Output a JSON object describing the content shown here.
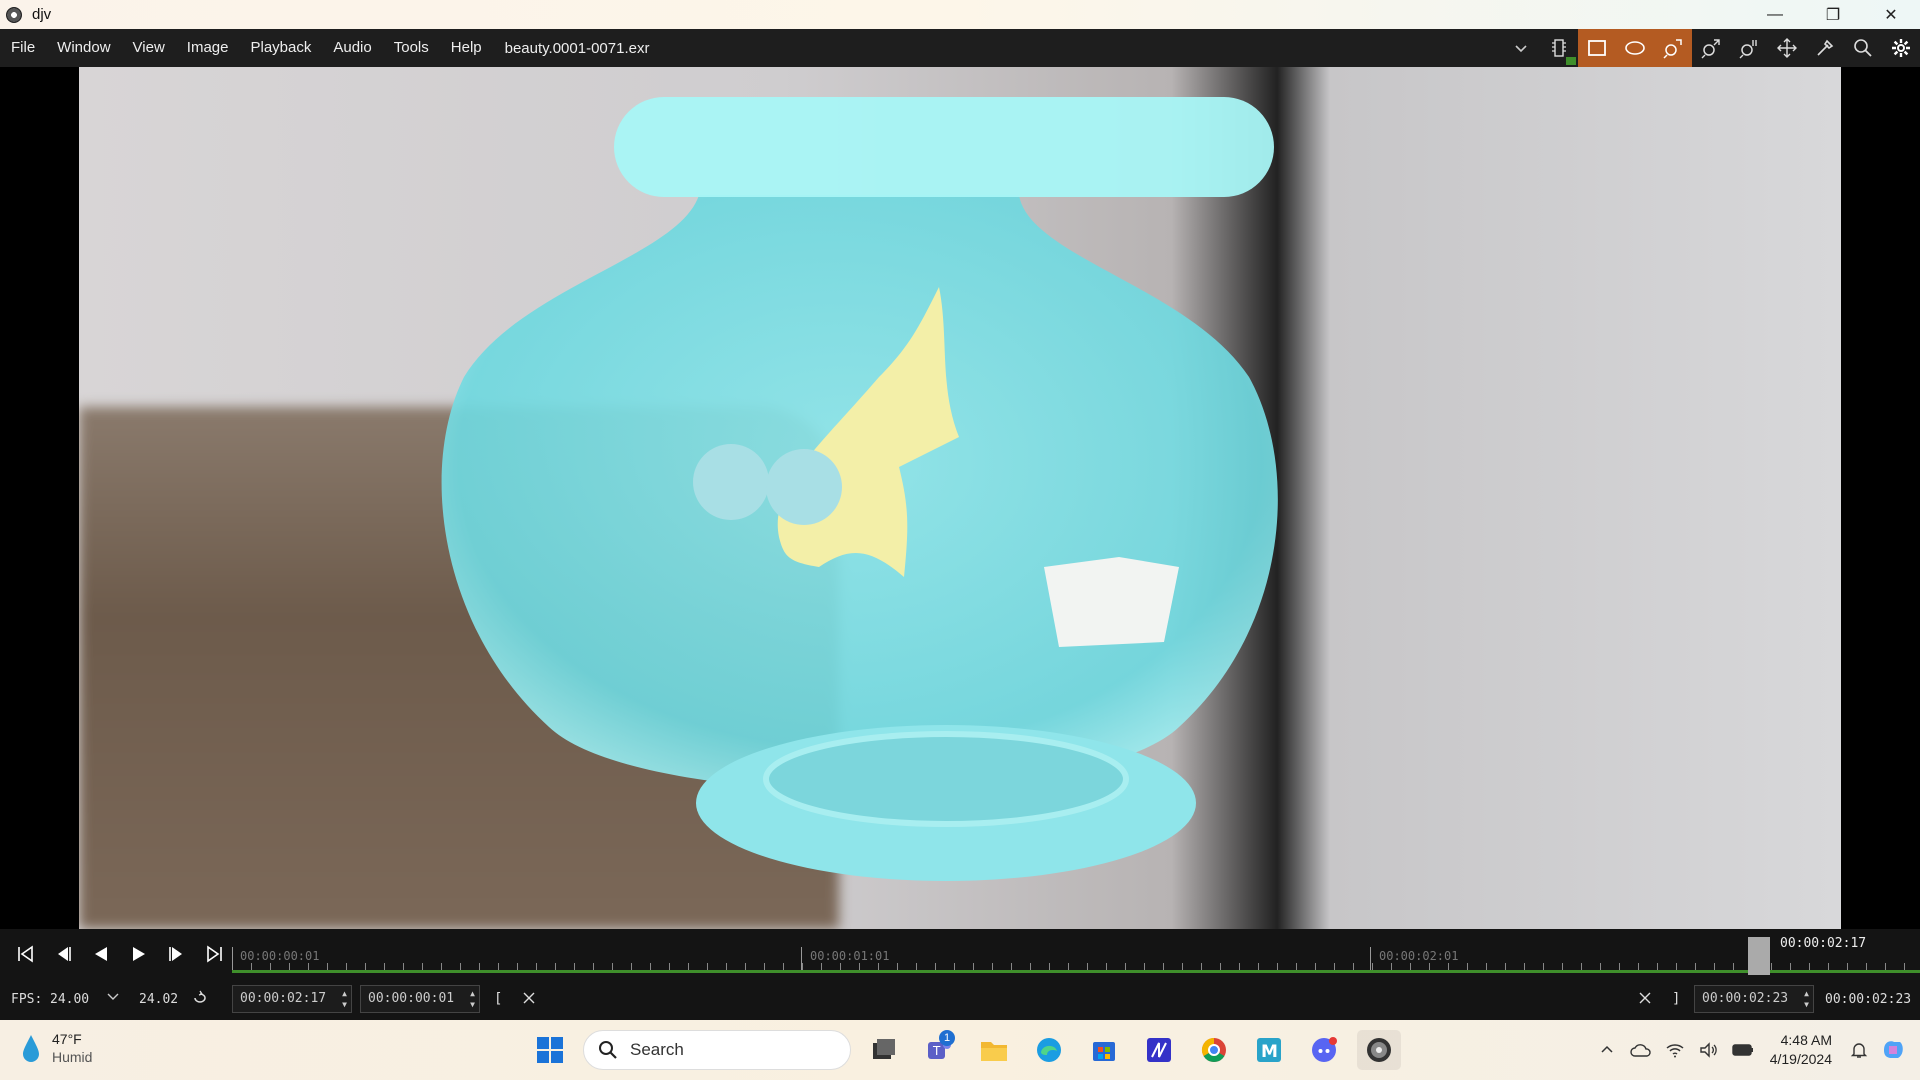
{
  "window": {
    "title": "djv",
    "minimize_glyph": "—",
    "restore_glyph": "❐",
    "close_glyph": "✕"
  },
  "menu": {
    "items": [
      "File",
      "Window",
      "View",
      "Image",
      "Playback",
      "Audio",
      "Tools",
      "Help"
    ],
    "filename": "beauty.0001-0071.exr"
  },
  "toolbar": {
    "icons": [
      "chevron-down-icon",
      "memory-icon",
      "rectangle-compare-icon",
      "ellipse-icon",
      "zoom-fit-icon",
      "zoom-in-icon",
      "zoom-reset-icon",
      "pan-icon",
      "color-picker-icon",
      "search-icon",
      "settings-icon"
    ],
    "active": [
      "rectangle-compare-icon",
      "ellipse-icon",
      "zoom-fit-icon"
    ],
    "accent": "#b45b22"
  },
  "timeline": {
    "labels": [
      "00:00:00:01",
      "00:00:01:01",
      "00:00:02:01"
    ],
    "current": "00:00:02:17",
    "bar_color": "#3f8f2b"
  },
  "playback": {
    "fps_label": "FPS:",
    "fps_value": "24.00",
    "actual_fps": "24.02",
    "current_time": "00:00:02:17",
    "step_time": "00:00:00:01",
    "in_marker": "[",
    "out_marker": "]",
    "out_time": "00:00:02:23",
    "duration": "00:00:02:23"
  },
  "taskbar": {
    "weather": {
      "temp": "47°F",
      "condition": "Humid"
    },
    "search_placeholder": "Search",
    "teams_badge": "1",
    "apps": [
      "windows-start-icon",
      "task-view-icon",
      "teams-icon",
      "file-explorer-icon",
      "edge-icon",
      "store-icon",
      "ai-app-icon",
      "chrome-icon",
      "mail-m-icon",
      "discord-icon",
      "djv-icon"
    ],
    "clock": {
      "time": "4:48 AM",
      "date": "4/19/2024"
    }
  }
}
